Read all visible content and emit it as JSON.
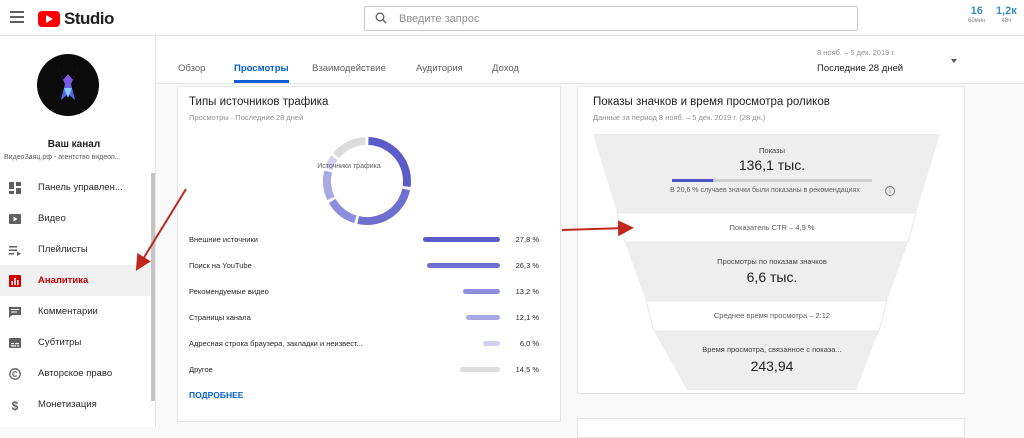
{
  "header": {
    "logo_text": "Studio",
    "search_placeholder": "Введите запрос",
    "stats": [
      {
        "value": "16",
        "label": "60мин"
      },
      {
        "value": "1,2к",
        "label": "48ч"
      }
    ]
  },
  "sidebar": {
    "channel_name": "Ваш канал",
    "channel_sub": "ВидеоЗаяц.рф - агентство видеоп...",
    "items": [
      {
        "label": "Панель управлен...",
        "icon": "dashboard-icon"
      },
      {
        "label": "Видео",
        "icon": "video-icon"
      },
      {
        "label": "Плейлисты",
        "icon": "playlist-icon"
      },
      {
        "label": "Аналитика",
        "icon": "analytics-icon",
        "active": true
      },
      {
        "label": "Комментарии",
        "icon": "comment-icon"
      },
      {
        "label": "Субтитры",
        "icon": "subtitles-icon"
      },
      {
        "label": "Авторское право",
        "icon": "copyright-icon"
      },
      {
        "label": "Монетизация",
        "icon": "dollar-icon"
      }
    ]
  },
  "tabs": [
    {
      "label": "Обзор"
    },
    {
      "label": "Просмотры",
      "active": true
    },
    {
      "label": "Взаимодействие"
    },
    {
      "label": "Аудитория"
    },
    {
      "label": "Доход"
    }
  ],
  "date_range": {
    "range": "8 нояб. – 5 дек. 2019 г.",
    "selected": "Последние 28 дней"
  },
  "traffic_card": {
    "title": "Типы источников трафика",
    "subtitle": "Просмотры · Последние 28 дней",
    "donut_label": "Источники трафика",
    "more_link": "ПОДРОБНЕЕ",
    "sources": [
      {
        "label": "Внешние источники",
        "value": "27,8 %",
        "pct": 27.8,
        "color": "#5c5cc8"
      },
      {
        "label": "Поиск на YouTube",
        "value": "26,3 %",
        "pct": 26.3,
        "color": "#6f6fd0"
      },
      {
        "label": "Рекомендуемые видео",
        "value": "13,2 %",
        "pct": 13.2,
        "color": "#8e8ede"
      },
      {
        "label": "Страницы канала",
        "value": "12,1 %",
        "pct": 12.1,
        "color": "#a9a9e6"
      },
      {
        "label": "Адресная строка браузера, закладки и неизвест...",
        "value": "6,0 %",
        "pct": 6.0,
        "color": "#d2d2f0"
      },
      {
        "label": "Другое",
        "value": "14,5 %",
        "pct": 14.5,
        "color": "#dcdcdc"
      }
    ]
  },
  "funnel_card": {
    "title": "Показы значков и время просмотра роликов",
    "subtitle": "Данные за период 8 нояб. – 5 дек. 2019 г. (28 дн.)",
    "impressions_label": "Показы",
    "impressions_value": "136,1 тыс.",
    "impressions_progress": 0.206,
    "recommend_note": "В 20,6 % случаев значки были показаны в рекомендациях",
    "ctr": "Показатель CTR – 4,9 %",
    "views_label": "Просмотры по показам значков",
    "views_value": "6,6 тыс.",
    "avg_watch": "Среднее время просмотра – 2:12",
    "watch_label": "Время просмотра, связанное с показа...",
    "watch_value": "243,94"
  }
}
